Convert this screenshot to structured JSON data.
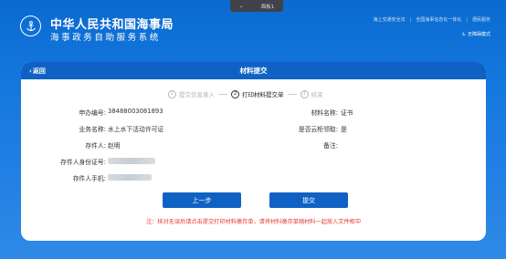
{
  "browser_tab": {
    "label": "面板1"
  },
  "brand": {
    "title": "中华人民共和国海事局",
    "subtitle": "海事政务自助服务系统"
  },
  "top_links": [
    "海上交通安全法",
    "全国海事信息化一体化",
    "便民服务"
  ],
  "accessibility": {
    "label": "无障碍模式"
  },
  "panel": {
    "title": "材料提交",
    "back_label": "返回",
    "steps": [
      {
        "num": "1",
        "label": "提交信息录入"
      },
      {
        "num": "2",
        "label": "打印材料提交单"
      },
      {
        "num": "3",
        "label": "结束"
      }
    ],
    "fields": {
      "apply_no": {
        "label": "申办编号:",
        "value": "38488003081893"
      },
      "business_name": {
        "label": "业务名称:",
        "value": "水上水下活动许可证"
      },
      "depositor": {
        "label": "存件人:",
        "value": "赵明"
      },
      "depositor_id": {
        "label": "存件人身份证号:"
      },
      "depositor_phone": {
        "label": "存件人手机:"
      },
      "material_name": {
        "label": "材料名称:",
        "value": "证书"
      },
      "cloud_cabinet": {
        "label": "是否云柜领取:",
        "value": "是"
      },
      "remark": {
        "label": "备注:"
      }
    },
    "buttons": {
      "prev": "上一步",
      "submit": "提交"
    },
    "note": "注：核对无误后请点击提交打印材料缴存单，请将材料缴存单随材料一起放入文件柜中"
  }
}
